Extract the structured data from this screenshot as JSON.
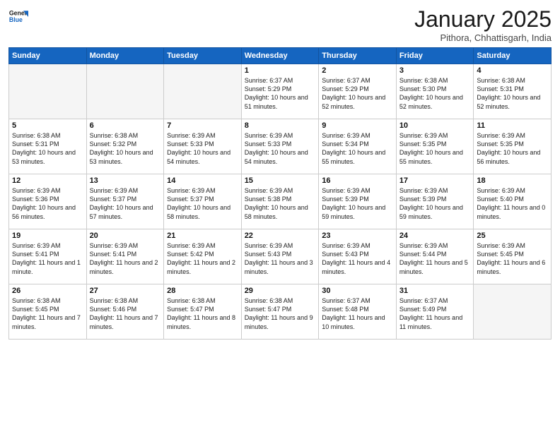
{
  "header": {
    "logo_line1": "General",
    "logo_line2": "Blue",
    "month": "January 2025",
    "location": "Pithora, Chhattisgarh, India"
  },
  "days_of_week": [
    "Sunday",
    "Monday",
    "Tuesday",
    "Wednesday",
    "Thursday",
    "Friday",
    "Saturday"
  ],
  "weeks": [
    [
      {
        "day": "",
        "info": ""
      },
      {
        "day": "",
        "info": ""
      },
      {
        "day": "",
        "info": ""
      },
      {
        "day": "1",
        "info": "Sunrise: 6:37 AM\nSunset: 5:29 PM\nDaylight: 10 hours\nand 51 minutes."
      },
      {
        "day": "2",
        "info": "Sunrise: 6:37 AM\nSunset: 5:29 PM\nDaylight: 10 hours\nand 52 minutes."
      },
      {
        "day": "3",
        "info": "Sunrise: 6:38 AM\nSunset: 5:30 PM\nDaylight: 10 hours\nand 52 minutes."
      },
      {
        "day": "4",
        "info": "Sunrise: 6:38 AM\nSunset: 5:31 PM\nDaylight: 10 hours\nand 52 minutes."
      }
    ],
    [
      {
        "day": "5",
        "info": "Sunrise: 6:38 AM\nSunset: 5:31 PM\nDaylight: 10 hours\nand 53 minutes."
      },
      {
        "day": "6",
        "info": "Sunrise: 6:38 AM\nSunset: 5:32 PM\nDaylight: 10 hours\nand 53 minutes."
      },
      {
        "day": "7",
        "info": "Sunrise: 6:39 AM\nSunset: 5:33 PM\nDaylight: 10 hours\nand 54 minutes."
      },
      {
        "day": "8",
        "info": "Sunrise: 6:39 AM\nSunset: 5:33 PM\nDaylight: 10 hours\nand 54 minutes."
      },
      {
        "day": "9",
        "info": "Sunrise: 6:39 AM\nSunset: 5:34 PM\nDaylight: 10 hours\nand 55 minutes."
      },
      {
        "day": "10",
        "info": "Sunrise: 6:39 AM\nSunset: 5:35 PM\nDaylight: 10 hours\nand 55 minutes."
      },
      {
        "day": "11",
        "info": "Sunrise: 6:39 AM\nSunset: 5:35 PM\nDaylight: 10 hours\nand 56 minutes."
      }
    ],
    [
      {
        "day": "12",
        "info": "Sunrise: 6:39 AM\nSunset: 5:36 PM\nDaylight: 10 hours\nand 56 minutes."
      },
      {
        "day": "13",
        "info": "Sunrise: 6:39 AM\nSunset: 5:37 PM\nDaylight: 10 hours\nand 57 minutes."
      },
      {
        "day": "14",
        "info": "Sunrise: 6:39 AM\nSunset: 5:37 PM\nDaylight: 10 hours\nand 58 minutes."
      },
      {
        "day": "15",
        "info": "Sunrise: 6:39 AM\nSunset: 5:38 PM\nDaylight: 10 hours\nand 58 minutes."
      },
      {
        "day": "16",
        "info": "Sunrise: 6:39 AM\nSunset: 5:39 PM\nDaylight: 10 hours\nand 59 minutes."
      },
      {
        "day": "17",
        "info": "Sunrise: 6:39 AM\nSunset: 5:39 PM\nDaylight: 10 hours\nand 59 minutes."
      },
      {
        "day": "18",
        "info": "Sunrise: 6:39 AM\nSunset: 5:40 PM\nDaylight: 11 hours\nand 0 minutes."
      }
    ],
    [
      {
        "day": "19",
        "info": "Sunrise: 6:39 AM\nSunset: 5:41 PM\nDaylight: 11 hours\nand 1 minute."
      },
      {
        "day": "20",
        "info": "Sunrise: 6:39 AM\nSunset: 5:41 PM\nDaylight: 11 hours\nand 2 minutes."
      },
      {
        "day": "21",
        "info": "Sunrise: 6:39 AM\nSunset: 5:42 PM\nDaylight: 11 hours\nand 2 minutes."
      },
      {
        "day": "22",
        "info": "Sunrise: 6:39 AM\nSunset: 5:43 PM\nDaylight: 11 hours\nand 3 minutes."
      },
      {
        "day": "23",
        "info": "Sunrise: 6:39 AM\nSunset: 5:43 PM\nDaylight: 11 hours\nand 4 minutes."
      },
      {
        "day": "24",
        "info": "Sunrise: 6:39 AM\nSunset: 5:44 PM\nDaylight: 11 hours\nand 5 minutes."
      },
      {
        "day": "25",
        "info": "Sunrise: 6:39 AM\nSunset: 5:45 PM\nDaylight: 11 hours\nand 6 minutes."
      }
    ],
    [
      {
        "day": "26",
        "info": "Sunrise: 6:38 AM\nSunset: 5:45 PM\nDaylight: 11 hours\nand 7 minutes."
      },
      {
        "day": "27",
        "info": "Sunrise: 6:38 AM\nSunset: 5:46 PM\nDaylight: 11 hours\nand 7 minutes."
      },
      {
        "day": "28",
        "info": "Sunrise: 6:38 AM\nSunset: 5:47 PM\nDaylight: 11 hours\nand 8 minutes."
      },
      {
        "day": "29",
        "info": "Sunrise: 6:38 AM\nSunset: 5:47 PM\nDaylight: 11 hours\nand 9 minutes."
      },
      {
        "day": "30",
        "info": "Sunrise: 6:37 AM\nSunset: 5:48 PM\nDaylight: 11 hours\nand 10 minutes."
      },
      {
        "day": "31",
        "info": "Sunrise: 6:37 AM\nSunset: 5:49 PM\nDaylight: 11 hours\nand 11 minutes."
      },
      {
        "day": "",
        "info": ""
      }
    ]
  ]
}
